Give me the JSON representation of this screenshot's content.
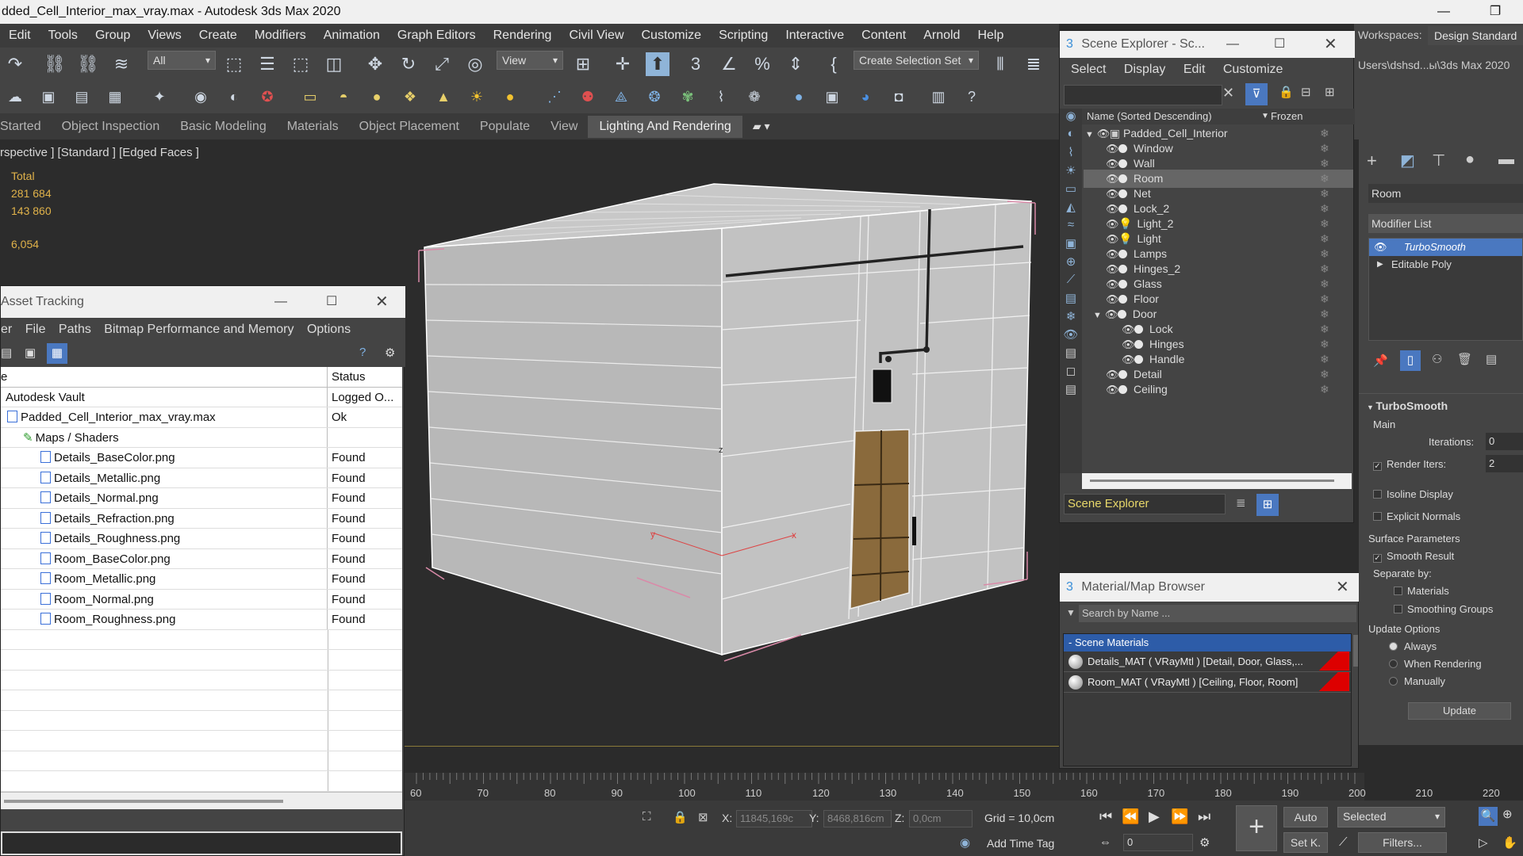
{
  "window": {
    "title": "dded_Cell_Interior_max_vray.max - Autodesk 3ds Max 2020",
    "minimize": "—",
    "restore": "❐"
  },
  "menu": [
    "Edit",
    "Tools",
    "Group",
    "Views",
    "Create",
    "Modifiers",
    "Animation",
    "Graph Editors",
    "Rendering",
    "Civil View",
    "Customize",
    "Scripting",
    "Interactive",
    "Content",
    "Arnold",
    "Help"
  ],
  "workspaces": {
    "label": "Workspaces:",
    "value": "Design Standard",
    "path": "Users\\dshsd...ы\\3ds Max 2020"
  },
  "toolbar": {
    "selection_filter": "All",
    "ref_coord": "View",
    "named_selection": "Create Selection Set"
  },
  "ribbon": {
    "tabs": [
      "Started",
      "Object Inspection",
      "Basic Modeling",
      "Materials",
      "Object Placement",
      "Populate",
      "View",
      "Lighting And Rendering"
    ],
    "active": "Lighting And Rendering"
  },
  "viewport": {
    "label": "rspective ] [Standard ] [Edged Faces ]",
    "stats": {
      "total_label": "Total",
      "polys": "281 684",
      "verts": "143 860",
      "fps": "6,054"
    }
  },
  "asset_tracking": {
    "title": "Asset Tracking",
    "menu": [
      "er",
      "File",
      "Paths",
      "Bitmap Performance and Memory",
      "Options"
    ],
    "col_name": "e",
    "col_status": "Status",
    "rows": [
      {
        "name": "Autodesk Vault",
        "status": "Logged O..."
      },
      {
        "name": "Padded_Cell_Interior_max_vray.max",
        "status": "Ok"
      },
      {
        "name": "Maps / Shaders",
        "status": ""
      },
      {
        "name": "Details_BaseColor.png",
        "status": "Found"
      },
      {
        "name": "Details_Metallic.png",
        "status": "Found"
      },
      {
        "name": "Details_Normal.png",
        "status": "Found"
      },
      {
        "name": "Details_Refraction.png",
        "status": "Found"
      },
      {
        "name": "Details_Roughness.png",
        "status": "Found"
      },
      {
        "name": "Room_BaseColor.png",
        "status": "Found"
      },
      {
        "name": "Room_Metallic.png",
        "status": "Found"
      },
      {
        "name": "Room_Normal.png",
        "status": "Found"
      },
      {
        "name": "Room_Roughness.png",
        "status": "Found"
      }
    ]
  },
  "scene_explorer": {
    "title": "Scene Explorer - Sc...",
    "menu": [
      "Select",
      "Display",
      "Edit",
      "Customize"
    ],
    "col_name": "Name (Sorted Descending)",
    "col_frozen": "Frozen",
    "items": [
      {
        "name": "Padded_Cell_Interior",
        "level": 0
      },
      {
        "name": "Window",
        "level": 1
      },
      {
        "name": "Wall",
        "level": 1
      },
      {
        "name": "Room",
        "level": 1
      },
      {
        "name": "Net",
        "level": 1
      },
      {
        "name": "Lock_2",
        "level": 1
      },
      {
        "name": "Light_2",
        "level": 1
      },
      {
        "name": "Light",
        "level": 1
      },
      {
        "name": "Lamps",
        "level": 1
      },
      {
        "name": "Hinges_2",
        "level": 1
      },
      {
        "name": "Glass",
        "level": 1
      },
      {
        "name": "Floor",
        "level": 1
      },
      {
        "name": "Door",
        "level": 1
      },
      {
        "name": "Lock",
        "level": 2
      },
      {
        "name": "Hinges",
        "level": 2
      },
      {
        "name": "Handle",
        "level": 2
      },
      {
        "name": "Detail",
        "level": 1
      },
      {
        "name": "Ceiling",
        "level": 1
      }
    ],
    "selected": "Room",
    "footer": "Scene Explorer"
  },
  "material_browser": {
    "title": "Material/Map Browser",
    "search_placeholder": "Search by Name ...",
    "group": "- Scene Materials",
    "materials": [
      "Details_MAT  ( VRayMtl )  [Detail, Door, Glass,...",
      "Room_MAT  ( VRayMtl )  [Ceiling, Floor, Room]"
    ]
  },
  "command_panel": {
    "object_name": "Room",
    "modifier_list": "Modifier List",
    "stack": [
      "TurboSmooth",
      "Editable Poly"
    ],
    "rollout": "TurboSmooth",
    "main": "Main",
    "iterations_label": "Iterations:",
    "iterations_value": "0",
    "render_iters_label": "Render Iters:",
    "render_iters_value": "2",
    "isoline": "Isoline Display",
    "explicit": "Explicit Normals",
    "surface": "Surface Parameters",
    "smooth_result": "Smooth Result",
    "separate_by": "Separate by:",
    "materials": "Materials",
    "smoothing_groups": "Smoothing Groups",
    "update_options": "Update Options",
    "always": "Always",
    "when_rendering": "When Rendering",
    "manually": "Manually",
    "update_btn": "Update"
  },
  "timeline": {
    "ticks": [
      "60",
      "70",
      "80",
      "90",
      "100",
      "110",
      "120",
      "130",
      "140",
      "150",
      "160",
      "170",
      "180",
      "190",
      "200",
      "210",
      "220"
    ]
  },
  "status": {
    "x_label": "X:",
    "x_value": "11845,169c",
    "y_label": "Y:",
    "y_value": "8468,816cm",
    "z_label": "Z:",
    "z_value": "0,0cm",
    "grid": "Grid = 10,0cm",
    "add_time_tag": "Add Time Tag",
    "auto": "Auto",
    "set_key": "Set K.",
    "selected": "Selected",
    "filters": "Filters...",
    "frame": "0"
  }
}
